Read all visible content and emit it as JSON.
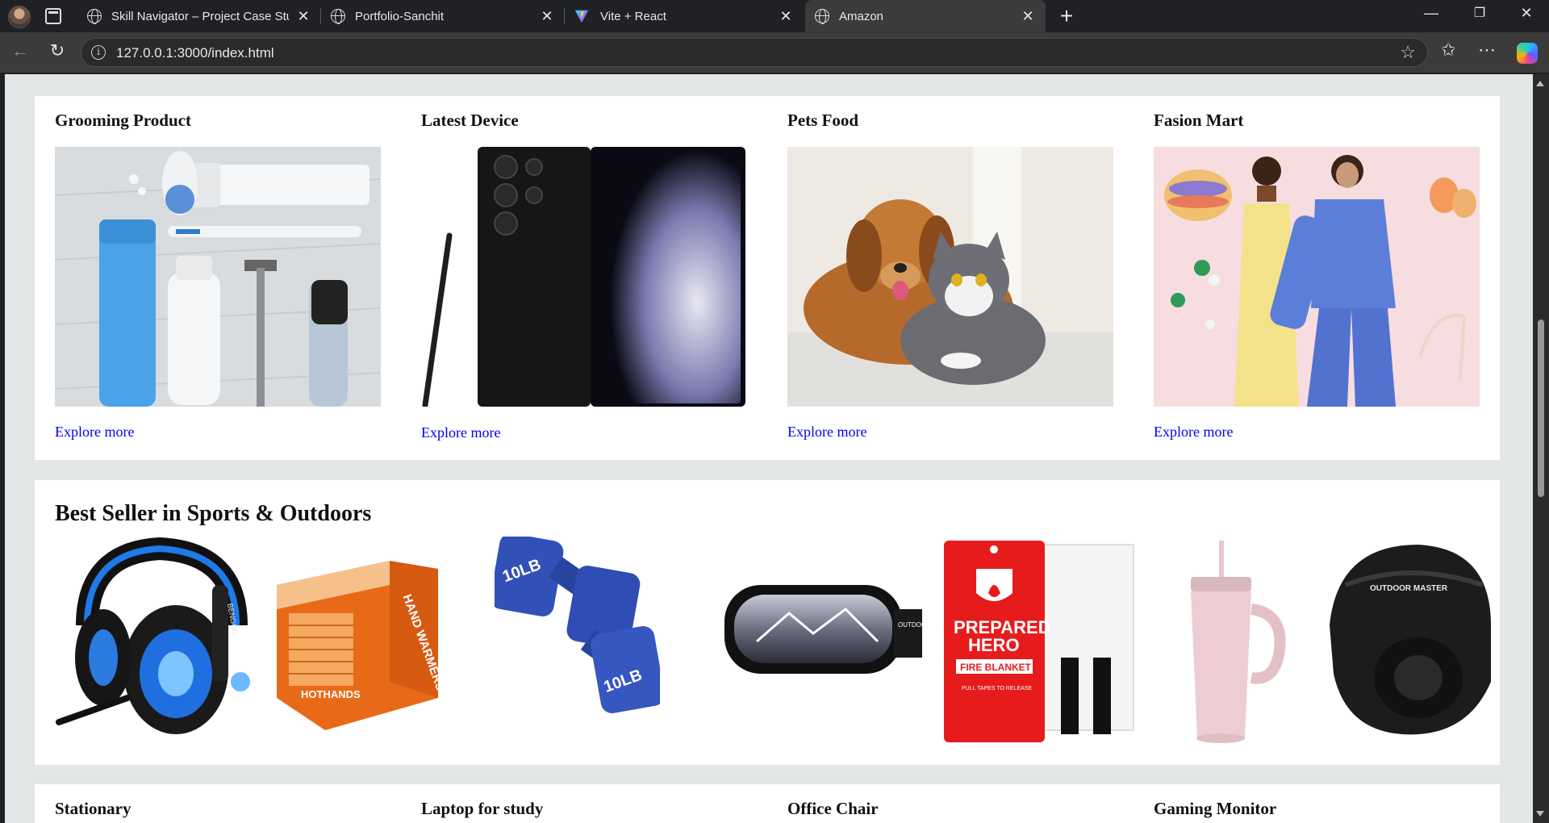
{
  "browser": {
    "tabs": [
      {
        "label": "Skill Navigator – Project Case Stuc",
        "icon": "globe-icon"
      },
      {
        "label": "Portfolio-Sanchit",
        "icon": "globe-icon"
      },
      {
        "label": "Vite + React",
        "icon": "vite-icon"
      },
      {
        "label": "Amazon",
        "icon": "globe-icon",
        "active": true
      }
    ],
    "url": "127.0.0.1:3000/index.html"
  },
  "category_row_1": [
    {
      "title": "Grooming Product",
      "link": "Explore more"
    },
    {
      "title": "Latest Device",
      "link": "Explore more"
    },
    {
      "title": "Pets Food",
      "link": "Explore more"
    },
    {
      "title": "Fasion Mart",
      "link": "Explore more"
    }
  ],
  "sports": {
    "title": "Best Seller in Sports & Outdoors",
    "products": [
      {
        "name": "gaming-headset-image",
        "brand_text": "BENGOO"
      },
      {
        "name": "hand-warmers-box-image",
        "brand_text": "HOTHANDS",
        "text": "HAND WARMERS"
      },
      {
        "name": "dumbbells-image",
        "weight_text": "10LB"
      },
      {
        "name": "ski-goggles-image",
        "brand_text": "OUTDOOR MASTER"
      },
      {
        "name": "fire-blanket-image",
        "line1": "PREPARED",
        "line2": "HERO",
        "line3": "FIRE BLANKET",
        "line4": "PULL TAPES TO RELEASE"
      },
      {
        "name": "tumbler-image"
      },
      {
        "name": "ski-helmet-image",
        "brand_text": "OUTDOOR MASTER"
      }
    ]
  },
  "category_row_2": [
    {
      "title": "Stationary"
    },
    {
      "title": "Laptop for study"
    },
    {
      "title": "Office Chair"
    },
    {
      "title": "Gaming Monitor"
    }
  ],
  "colors": {
    "page_bg": "#e3e6e6",
    "link": "#0000ee",
    "browser_bg": "#202124"
  }
}
